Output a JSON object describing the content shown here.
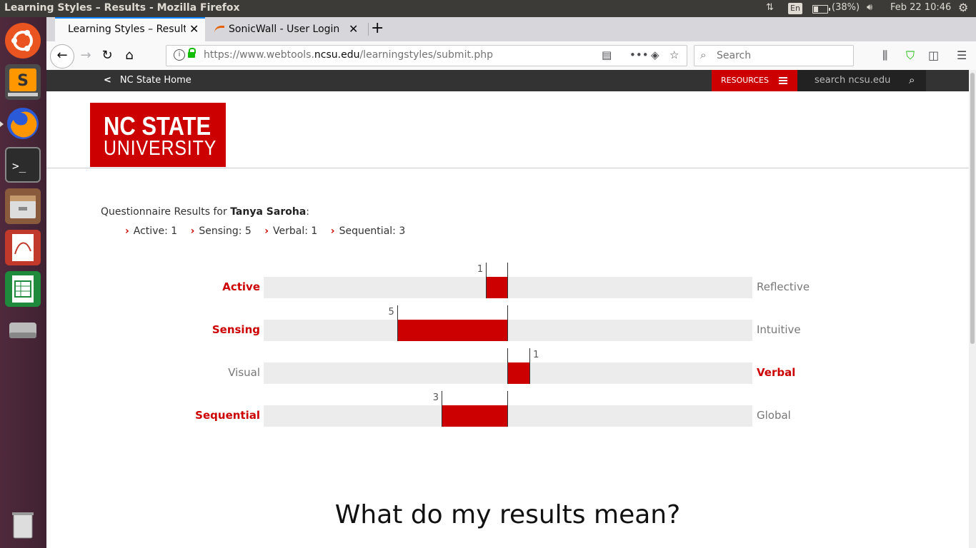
{
  "os": {
    "window_title": "Learning Styles – Results - Mozilla Firefox",
    "input_lang": "En",
    "battery": "(38%)",
    "datetime": "Feb 22 10:46"
  },
  "launcher": {
    "items": [
      "ubuntu-dash",
      "sublime-text",
      "firefox",
      "terminal",
      "file-manager",
      "document-viewer",
      "libreoffice-calc",
      "disk-drive",
      "trash"
    ]
  },
  "browser": {
    "tabs": [
      {
        "label": "Learning Styles – Results",
        "active": true
      },
      {
        "label": "SonicWall - User Login",
        "active": false
      }
    ],
    "url_prefix": "https://www.webtools.",
    "url_domain": "ncsu.edu",
    "url_suffix": "/learningstyles/submit.php",
    "search_placeholder": "Search"
  },
  "site": {
    "home_link": "NC State Home",
    "resources": "RESOURCES",
    "search_placeholder": "search ncsu.edu",
    "logo_line1": "NC STATE",
    "logo_line2": "UNIVERSITY"
  },
  "results": {
    "heading_prefix": "Questionnaire Results for ",
    "name": "Tanya Saroha",
    "heading_suffix": ":",
    "scores": [
      {
        "text": "Active: 1"
      },
      {
        "text": "Sensing: 5"
      },
      {
        "text": "Verbal: 1"
      },
      {
        "text": "Sequential: 3"
      }
    ]
  },
  "chart_data": {
    "type": "bar",
    "scale": [
      -11,
      11
    ],
    "rows": [
      {
        "left": "Active",
        "right": "Reflective",
        "dominant": "left",
        "value": 1
      },
      {
        "left": "Sensing",
        "right": "Intuitive",
        "dominant": "left",
        "value": 5
      },
      {
        "left": "Visual",
        "right": "Verbal",
        "dominant": "right",
        "value": 1
      },
      {
        "left": "Sequential",
        "right": "Global",
        "dominant": "left",
        "value": 3
      }
    ],
    "colors": {
      "bar": "#cc0000",
      "track": "#ececec"
    }
  },
  "section_heading": "What do my results mean?"
}
